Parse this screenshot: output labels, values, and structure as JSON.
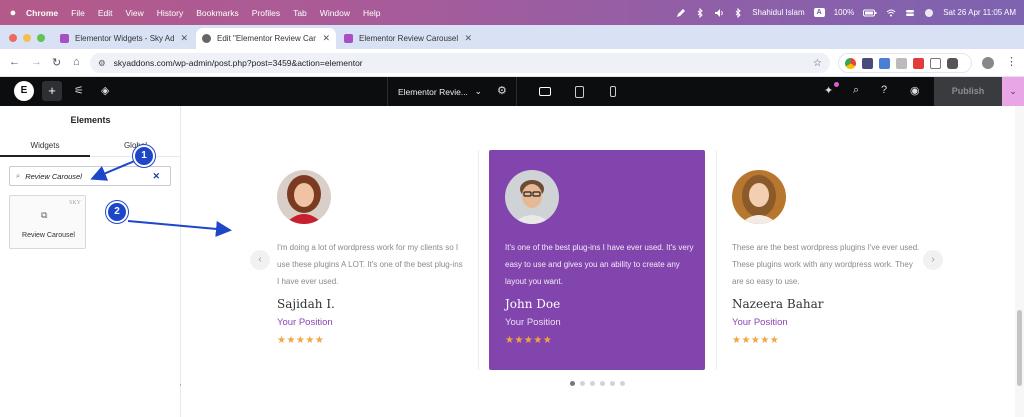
{
  "menubar": {
    "app": "Chrome",
    "items": [
      "File",
      "Edit",
      "View",
      "History",
      "Bookmarks",
      "Profiles",
      "Tab",
      "Window",
      "Help"
    ],
    "user": "Shahidul Islam",
    "input_badge": "A",
    "battery": "100%",
    "datetime": "Sat 26 Apr  11:05 AM"
  },
  "tabs": [
    {
      "title": "Elementor Widgets - Sky Addons",
      "active": false,
      "favicon_color": "#a94fc6"
    },
    {
      "title": "Edit \"Elementor Review Carousel\"",
      "active": true,
      "favicon_color": "#666666"
    },
    {
      "title": "Elementor Review Carousel Widget",
      "active": false,
      "favicon_color": "#a94fc6"
    }
  ],
  "address": {
    "url": "skyaddons.com/wp-admin/post.php?post=3459&action=elementor"
  },
  "editor": {
    "page_name": "Elementor Revie...",
    "publish_label": "Publish"
  },
  "panel": {
    "title": "Elements",
    "tabs": [
      "Widgets",
      "Global"
    ],
    "search_value": "Review Carousel",
    "widget_label": "Review Carousel",
    "widget_brand": "SKY"
  },
  "annotations": {
    "step1": "1",
    "step2": "2",
    "color": "#1d46c9"
  },
  "carousel": {
    "cards": [
      {
        "quote": "I'm doing a lot of wordpress work for my clients so I use these plugins A LOT. It's one of the best plug-ins I have ever used.",
        "name": "Sajidah I.",
        "role": "Your Position",
        "rating": 5,
        "stars": "★★★★★",
        "featured": false
      },
      {
        "quote": "It's one of the best plug-ins I have ever used. It's very easy to use and gives you an ability to create any layout you want.",
        "name": "John Doe",
        "role": "Your Position",
        "rating": 5,
        "stars": "★★★★★",
        "featured": true
      },
      {
        "quote": "These are the best wordpress plugins I've ever used. These plugins work with any wordpress work. They are so easy to use.",
        "name": "Nazeera Bahar",
        "role": "Your Position",
        "rating": 5,
        "stars": "★★★★★",
        "featured": false
      }
    ],
    "dots_count": 6,
    "active_dot": 1,
    "accent_color": "#8244ad",
    "star_color": "#f0a641"
  }
}
